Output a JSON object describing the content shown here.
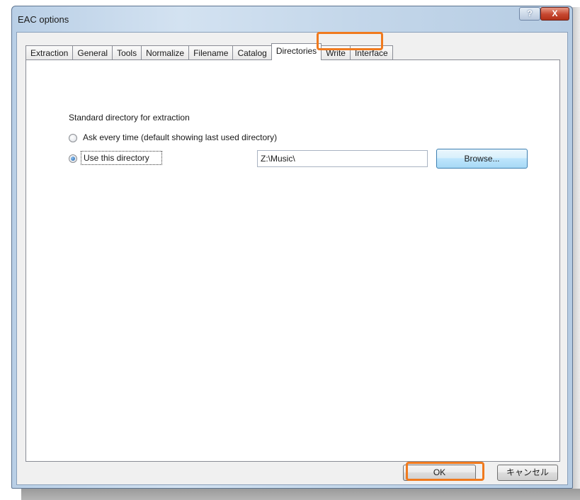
{
  "window": {
    "title": "EAC options",
    "help_label": "?",
    "close_label": "X"
  },
  "tabs": [
    {
      "label": "Extraction",
      "active": false
    },
    {
      "label": "General",
      "active": false
    },
    {
      "label": "Tools",
      "active": false
    },
    {
      "label": "Normalize",
      "active": false
    },
    {
      "label": "Filename",
      "active": false
    },
    {
      "label": "Catalog",
      "active": false
    },
    {
      "label": "Directories",
      "active": true
    },
    {
      "label": "Write",
      "active": false
    },
    {
      "label": "Interface",
      "active": false
    }
  ],
  "directories": {
    "group_label": "Standard directory for extraction",
    "option_ask": "Ask every time (default showing last used directory)",
    "option_use": "Use this directory",
    "selected_option": "use",
    "directory_value": "Z:\\Music\\",
    "browse_label": "Browse..."
  },
  "footer": {
    "ok_label": "OK",
    "cancel_label": "キャンセル"
  },
  "colors": {
    "highlight": "#f07a1e",
    "title_bar": "#c4d7ea",
    "close_button": "#c6472f"
  }
}
